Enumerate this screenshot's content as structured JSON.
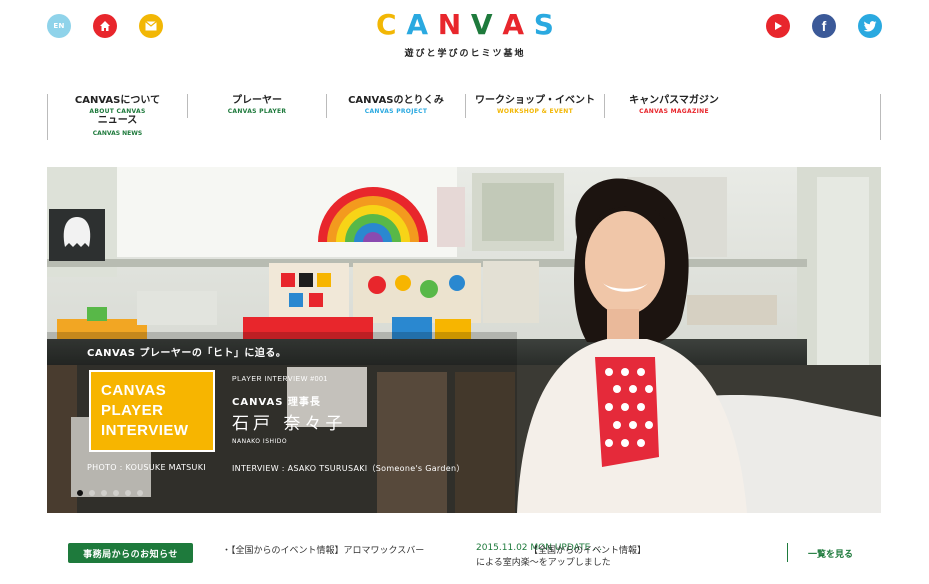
{
  "header": {
    "lang_label": "EN",
    "logo_letters": [
      {
        "char": "C",
        "color": "#f2b705"
      },
      {
        "char": "A",
        "color": "#2aa9e0"
      },
      {
        "char": "N",
        "color": "#e8262c"
      },
      {
        "char": "V",
        "color": "#1e7a3c"
      },
      {
        "char": "A",
        "color": "#e8262c"
      },
      {
        "char": "S",
        "color": "#2aa9e0"
      }
    ],
    "tagline": "遊びと学びのヒミツ基地",
    "facebook_glyph": "f"
  },
  "nav": {
    "items": [
      {
        "jp": "CANVASについて",
        "en": "ABOUT CANVAS",
        "color": "#1e7a3c"
      },
      {
        "jp": "プレーヤー",
        "en": "CANVAS PLAYER",
        "color": "#1e7a3c"
      },
      {
        "jp": "CANVASのとりくみ",
        "en": "CANVAS PROJECT",
        "color": "#2aa9e0"
      },
      {
        "jp": "ワークショップ・イベント",
        "en": "WORKSHOP & EVENT",
        "color": "#f2b705"
      },
      {
        "jp": "キャンパスマガジン",
        "en": "CANVAS MAGAZINE",
        "color": "#e8262c"
      }
    ],
    "news": {
      "jp": "ニュース",
      "en": "CANVAS NEWS",
      "color": "#1e7a3c"
    }
  },
  "hero": {
    "tagline": "CANVAS プレーヤーの「ヒト」に迫る。",
    "badge_lines": [
      "CANVAS",
      "PLAYER",
      "INTERVIEW"
    ],
    "interview_label": "PLAYER INTERVIEW #001",
    "role": "CANVAS 理事長",
    "name": "石戸 奈々子",
    "romaji": "NANAKO ISHIDO",
    "photo_credit": "PHOTO : KOUSUKE MATSUKI",
    "interview_credit": "INTERVIEW : ASAKO TSURUSAKI（Someone's Garden）",
    "slide_count": 6,
    "active_slide": 1
  },
  "news_bar": {
    "tag": "事務局からのお知らせ",
    "item1": "・【全国からのイベント情報】アロマワックスバー",
    "date": "2015.11.02 MON UPDATE …",
    "item2_line1": "【全国からのイベント情報】",
    "item2_line2": "による室内楽〜をアップしました",
    "more": "一覧を見る"
  },
  "colors": {
    "green": "#1e7a3c",
    "red": "#e8262c",
    "yellow": "#f7b500",
    "blue": "#2aa9e0",
    "facebook": "#3b5998"
  }
}
